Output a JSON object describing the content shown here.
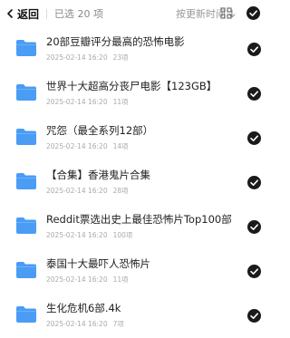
{
  "header": {
    "back_label": "返回",
    "selected_label": "已选 20 项",
    "sort_label": "按更新时间"
  },
  "files": [
    {
      "name": "20部豆瓣评分最高的恐怖电影",
      "date": "2025-02-14 16:20",
      "size": "23项"
    },
    {
      "name": "世界十大超高分丧尸电影【123GB】",
      "date": "2025-02-14 16:20",
      "size": "11项"
    },
    {
      "name": "咒怨（最全系列12部）",
      "date": "2025-02-14 16:20",
      "size": "14项"
    },
    {
      "name": "【合集】香港鬼片合集",
      "date": "2025-02-14 16:20",
      "size": "28项"
    },
    {
      "name": "Reddit票选出史上最佳恐怖片Top100部",
      "date": "2025-02-14 16:20",
      "size": "100项"
    },
    {
      "name": "泰国十大最吓人恐怖片",
      "date": "2025-02-14 16:20",
      "size": "11项"
    },
    {
      "name": "生化危机6部.4k",
      "date": "2025-02-14 16:20",
      "size": "7项"
    }
  ],
  "colors": {
    "folder": "#4a9cf5",
    "check": "#1a1a1a"
  },
  "icons": [
    "chevron-left-icon",
    "arrow-down-icon",
    "grid-view-icon",
    "check-circle-icon",
    "folder-icon"
  ]
}
